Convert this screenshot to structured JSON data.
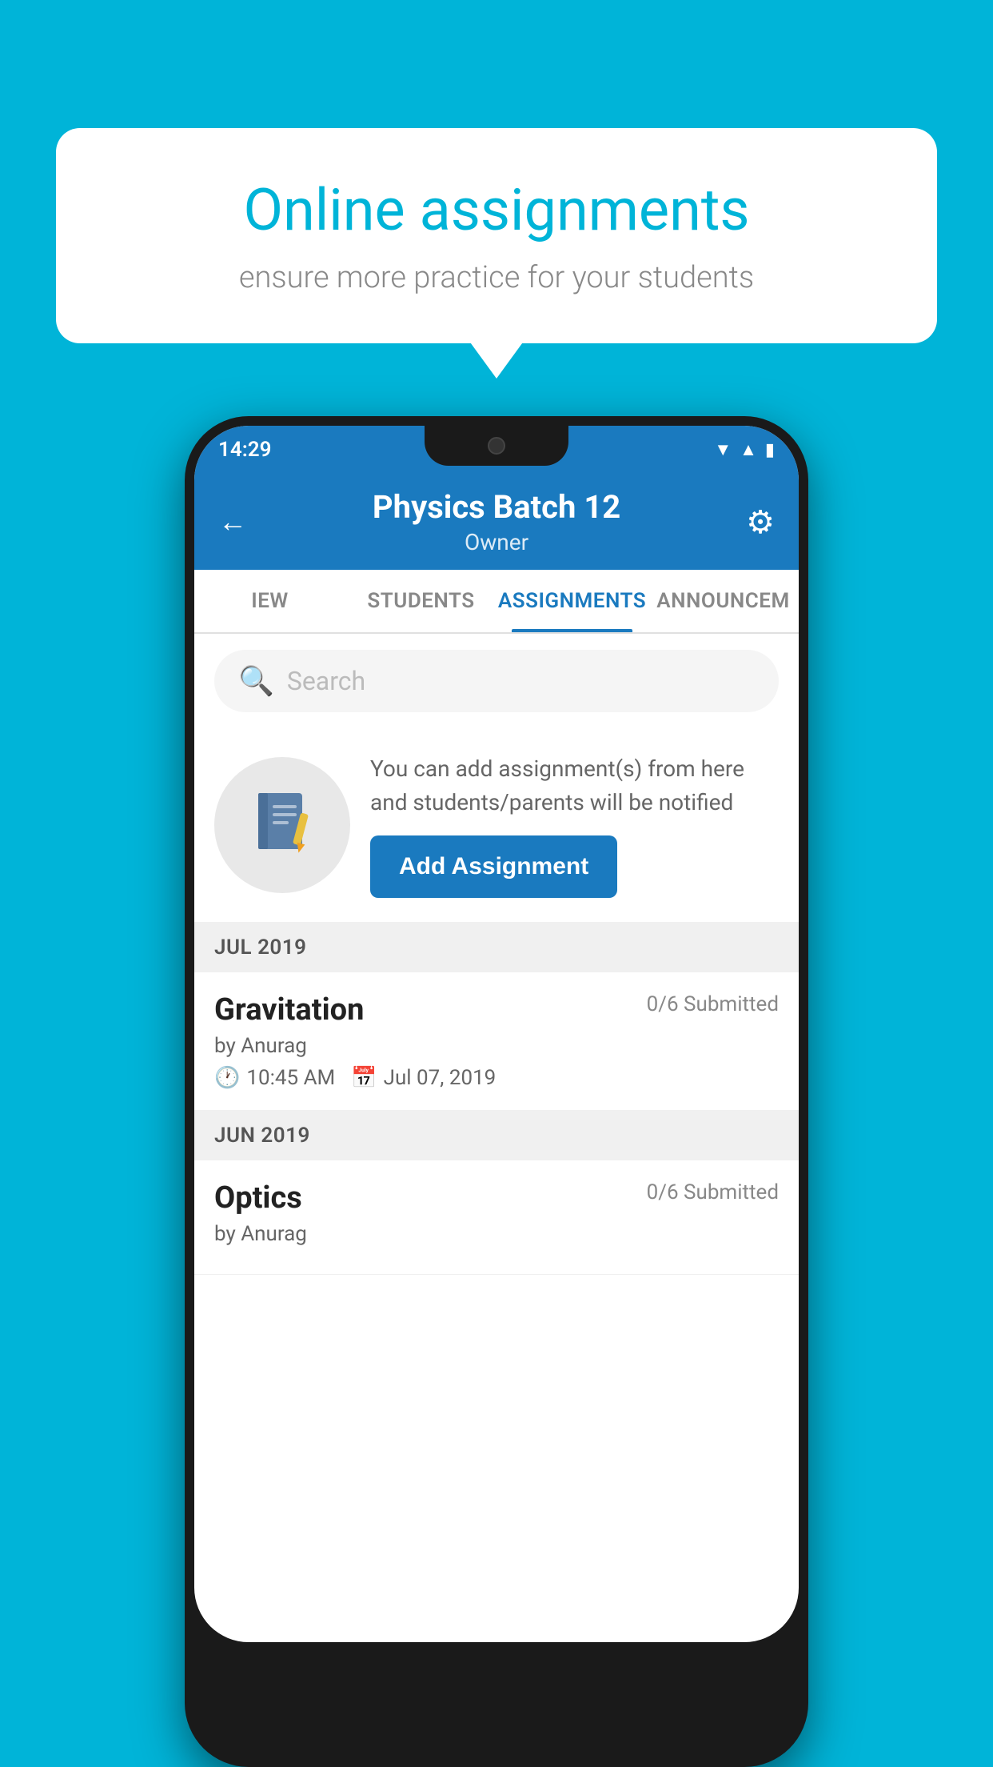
{
  "background_color": "#00b4d8",
  "speech_bubble": {
    "title": "Online assignments",
    "subtitle": "ensure more practice for your students"
  },
  "status_bar": {
    "time": "14:29",
    "icons": [
      "wifi",
      "signal",
      "battery"
    ]
  },
  "header": {
    "title": "Physics Batch 12",
    "subtitle": "Owner",
    "back_label": "←",
    "gear_label": "⚙"
  },
  "tabs": [
    {
      "label": "IEW",
      "active": false
    },
    {
      "label": "STUDENTS",
      "active": false
    },
    {
      "label": "ASSIGNMENTS",
      "active": true
    },
    {
      "label": "ANNOUNCEM",
      "active": false
    }
  ],
  "search": {
    "placeholder": "Search"
  },
  "promo": {
    "description": "You can add assignment(s) from here and students/parents will be notified",
    "button_label": "Add Assignment"
  },
  "sections": [
    {
      "label": "JUL 2019",
      "assignments": [
        {
          "title": "Gravitation",
          "submitted": "0/6 Submitted",
          "by": "by Anurag",
          "time": "10:45 AM",
          "date": "Jul 07, 2019"
        }
      ]
    },
    {
      "label": "JUN 2019",
      "assignments": [
        {
          "title": "Optics",
          "submitted": "0/6 Submitted",
          "by": "by Anurag",
          "time": "",
          "date": ""
        }
      ]
    }
  ]
}
